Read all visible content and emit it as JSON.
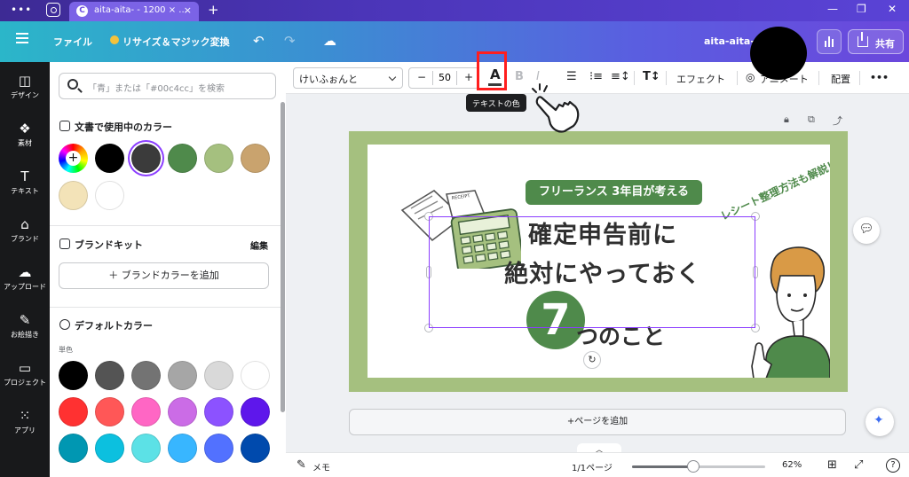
{
  "browser": {
    "tab_title": "aita-aita- - 1200 × ...",
    "tab_logo": "C",
    "close": "×",
    "new_tab": "+",
    "menu_dots": "•••",
    "win_min": "—",
    "win_max": "❐",
    "win_close": "✕"
  },
  "header": {
    "file_label": "ファイル",
    "resize_label": "リサイズ＆マジック変換",
    "undo_icon": "↶",
    "redo_icon": "↷",
    "cloud_icon": "☁",
    "design_title": "aita-aita-",
    "share_label": "共有"
  },
  "rail": [
    {
      "icon": "◫",
      "label": "デザイン"
    },
    {
      "icon": "❖",
      "label": "素材"
    },
    {
      "icon": "T",
      "label": "テキスト"
    },
    {
      "icon": "⌂",
      "label": "ブランド"
    },
    {
      "icon": "☁",
      "label": "アップロード"
    },
    {
      "icon": "✎",
      "label": "お絵描き"
    },
    {
      "icon": "▭",
      "label": "プロジェクト"
    },
    {
      "icon": "⁙",
      "label": "アプリ"
    }
  ],
  "panel": {
    "search_placeholder": "「青」または「#00c4cc」を検索",
    "doc_colors_title": "文書で使用中のカラー",
    "doc_colors": [
      "#000000",
      "#3b3b3b",
      "#4f8a4b",
      "#a5c07f",
      "#c9a36e",
      "#f3e3b8",
      "#ffffff"
    ],
    "doc_colors_selected_index": 1,
    "brand_title": "ブランドキット",
    "brand_action": "編集",
    "brand_add": "＋  ブランドカラーを追加",
    "default_title": "デフォルトカラー",
    "mono_label": "単色",
    "default_rows": [
      [
        "#000000",
        "#545454",
        "#737373",
        "#a6a6a6",
        "#d9d9d9",
        "#ffffff"
      ],
      [
        "#ff3131",
        "#ff5757",
        "#ff66c4",
        "#cb6ce6",
        "#8c52ff",
        "#5e17eb"
      ],
      [
        "#0097b2",
        "#0cc0df",
        "#5ce1e6",
        "#38b6ff",
        "#5271ff",
        "#004aad"
      ]
    ]
  },
  "toolbar": {
    "font": "けいふぉんと",
    "minus": "−",
    "size": "50",
    "plus": "+",
    "color_letter": "A",
    "bold": "B",
    "italic": "I",
    "effects": "エフェクト",
    "animate": "アニメート",
    "position": "配置",
    "more": "•••",
    "tooltip": "テキストの色"
  },
  "canvas": {
    "tag": "フリーランス 3年目が考える",
    "line1": "確定申告前に",
    "line2": "絶対にやっておく",
    "seven": "7",
    "rest": "つのこと",
    "curve": "レシート整理方法も解説！",
    "add_page": "+ページを追加",
    "rotate_icon": "↻"
  },
  "footer": {
    "notes": "メモ",
    "pages": "1/1ページ",
    "zoom": "62%",
    "zoom_fraction": 0.46
  }
}
